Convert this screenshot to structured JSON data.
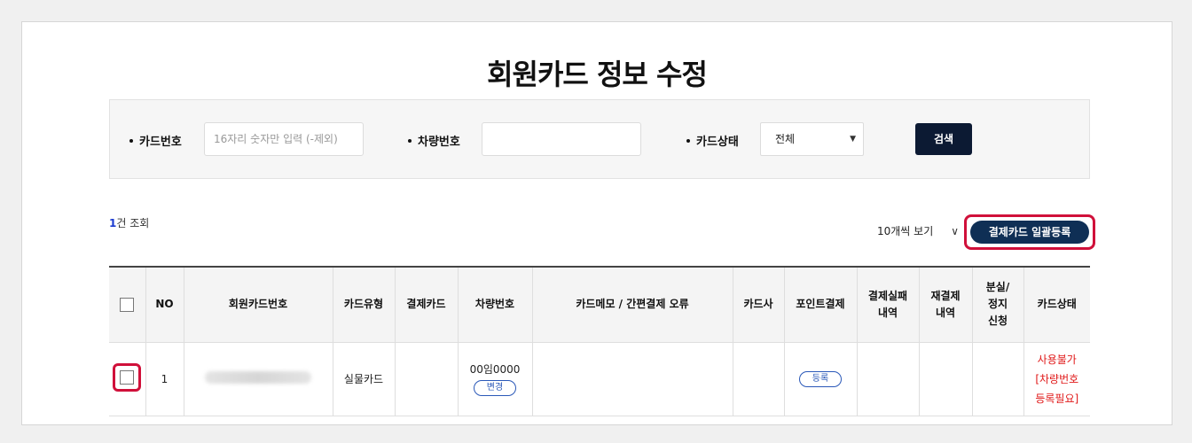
{
  "page_title": "회원카드 정보 수정",
  "search": {
    "card_number_label": "카드번호",
    "card_number_placeholder": "16자리 숫자만 입력 (-제외)",
    "vehicle_number_label": "차량번호",
    "vehicle_number_value": "",
    "card_status_label": "카드상태",
    "card_status_selected": "전체",
    "search_button": "검색"
  },
  "result": {
    "count": "1",
    "count_suffix": "건 조회"
  },
  "per_page": {
    "selected": "10개씩 보기"
  },
  "bulk_register_button": "결제카드 일괄등록",
  "table": {
    "headers": {
      "no": "NO",
      "member_card_number": "회원카드번호",
      "card_type": "카드유형",
      "payment_card": "결제카드",
      "vehicle_number": "차량번호",
      "card_memo": "카드메모 / 간편결제 오류",
      "card_company": "카드사",
      "point_payment": "포인트결제",
      "payment_fail_line1": "결제실패",
      "payment_fail_line2": "내역",
      "repayment_line1": "재결제",
      "repayment_line2": "내역",
      "lost_line1": "분실/",
      "lost_line2": "정지",
      "lost_line3": "신청",
      "card_status": "카드상태"
    },
    "rows": [
      {
        "no": "1",
        "member_card_number": "",
        "card_type": "실물카드",
        "payment_card": "",
        "vehicle_number": "00임0000",
        "vehicle_change_button": "변경",
        "card_memo": "",
        "card_company": "",
        "point_button": "등록",
        "payment_fail": "",
        "repayment": "",
        "lost": "",
        "status_line1": "사용불가",
        "status_line2": "[차량번호",
        "status_line3": "등록필요]"
      }
    ]
  },
  "colors": {
    "primary_dark": "#0c1a33",
    "highlight": "#d0103a",
    "link_blue": "#2a58b8",
    "status_red": "#e01818"
  }
}
